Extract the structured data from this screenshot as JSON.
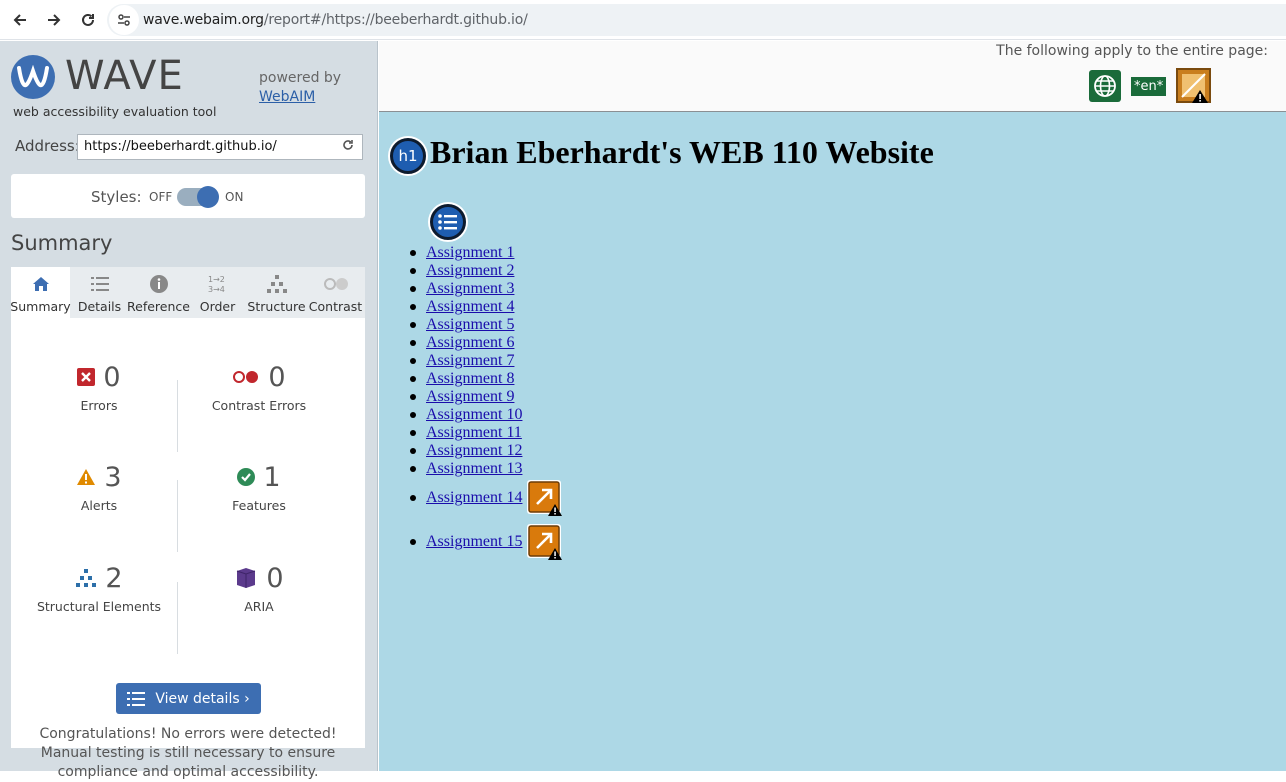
{
  "browser": {
    "url_host": "wave.webaim.org",
    "url_path": "/report#/https://beeberhardt.github.io/"
  },
  "sidebar": {
    "logo_word": "WAVE",
    "tagline": "web accessibility evaluation tool",
    "powered_by": "powered by",
    "webaim_link": "WebAIM",
    "address_label": "Address:",
    "address_value": "https://beeberhardt.github.io/",
    "styles_label": "Styles:",
    "styles_off": "OFF",
    "styles_on": "ON",
    "summary_heading": "Summary",
    "tabs": [
      {
        "label": "Summary",
        "icon": "home-icon"
      },
      {
        "label": "Details",
        "icon": "list-icon"
      },
      {
        "label": "Reference",
        "icon": "info-icon"
      },
      {
        "label": "Order",
        "icon": "order-icon"
      },
      {
        "label": "Structure",
        "icon": "structure-icon"
      },
      {
        "label": "Contrast",
        "icon": "contrast-icon"
      }
    ],
    "stats": {
      "errors": {
        "value": "0",
        "label": "Errors"
      },
      "contrast": {
        "value": "0",
        "label": "Contrast Errors"
      },
      "alerts": {
        "value": "3",
        "label": "Alerts"
      },
      "features": {
        "value": "1",
        "label": "Features"
      },
      "structural": {
        "value": "2",
        "label": "Structural Elements"
      },
      "aria": {
        "value": "0",
        "label": "ARIA"
      }
    },
    "view_details": "View details ›",
    "congrats": "Congratulations! No errors were detected! Manual testing is still necessary to ensure compliance and optimal accessibility."
  },
  "report": {
    "entire_page_text": "The following apply to the entire page:",
    "lang_badge": "*en*",
    "h1_badge": "h1",
    "page_title": "Brian Eberhardt's WEB 110 Website",
    "assignments": [
      "Assignment 1",
      "Assignment 2",
      "Assignment 3",
      "Assignment 4",
      "Assignment 5",
      "Assignment 6",
      "Assignment 7",
      "Assignment 8",
      "Assignment 9",
      "Assignment 10",
      "Assignment 11",
      "Assignment 12",
      "Assignment 13",
      "Assignment 14",
      "Assignment 15"
    ]
  },
  "colors": {
    "wave_blue": "#3d6eb2",
    "content_bg": "#add8e6",
    "error_red": "#c1272d",
    "alert_orange": "#e08a00",
    "feature_green": "#2e8b57",
    "aria_purple": "#5b3a8c"
  }
}
